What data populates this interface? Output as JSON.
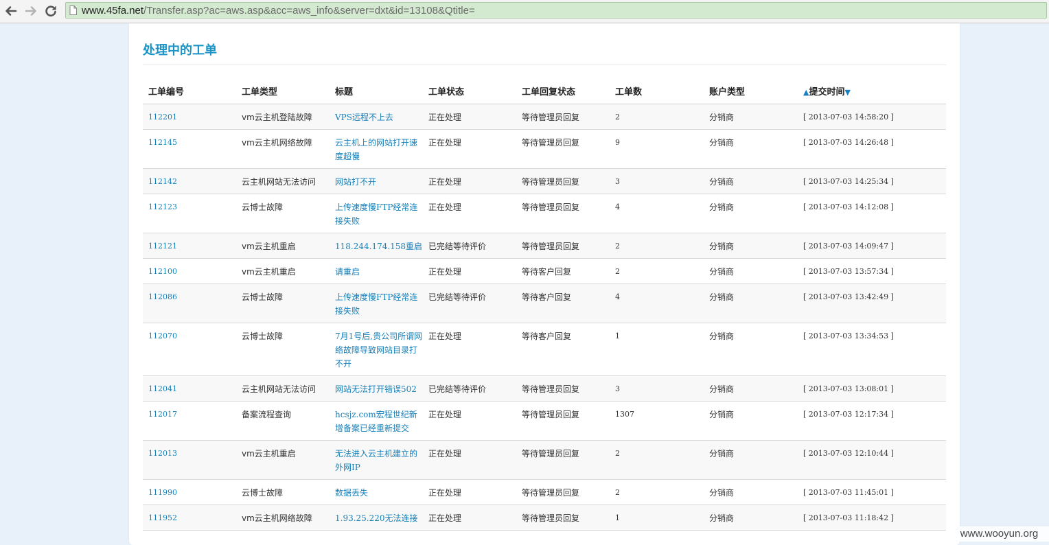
{
  "browser": {
    "url_host": "www.45fa.net",
    "url_path": "/Transfer.asp?ac=aws.asp&acc=aws_info&server=dxt&id=13108&Qtitle=",
    "icons": [
      "back-arrow-icon",
      "forward-arrow-icon",
      "reload-icon",
      "page-icon"
    ]
  },
  "page": {
    "title": "处理中的工单"
  },
  "table": {
    "headers": {
      "id": "工单编号",
      "category": "工单类型",
      "subject": "标题",
      "status": "工单状态",
      "reply_status": "工单回复状态",
      "count": "工单数",
      "account": "账户类型",
      "time": "提交时间"
    },
    "sort_up": "▲",
    "sort_down": "▼",
    "rows": [
      {
        "id": "112201",
        "category": "vm云主机登陆故障",
        "subject": "VPS远程不上去",
        "status": "正在处理",
        "reply_status": "等待管理员回复",
        "count": "2",
        "account": "分销商",
        "time": "[ 2013-07-03 14:58:20 ]"
      },
      {
        "id": "112145",
        "category": "vm云主机网络故障",
        "subject": "云主机上的网站打开速度超慢",
        "status": "正在处理",
        "reply_status": "等待管理员回复",
        "count": "9",
        "account": "分销商",
        "time": "[ 2013-07-03 14:26:48 ]"
      },
      {
        "id": "112142",
        "category": "云主机网站无法访问",
        "subject": "网站打不开",
        "status": "正在处理",
        "reply_status": "等待管理员回复",
        "count": "3",
        "account": "分销商",
        "time": "[ 2013-07-03 14:25:34 ]"
      },
      {
        "id": "112123",
        "category": "云博士故障",
        "subject": "上传速度慢FTP经常连接失败",
        "status": "正在处理",
        "reply_status": "等待管理员回复",
        "count": "4",
        "account": "分销商",
        "time": "[ 2013-07-03 14:12:08 ]"
      },
      {
        "id": "112121",
        "category": "vm云主机重启",
        "subject": "118.244.174.158重启",
        "status": "已完结等待评价",
        "reply_status": "等待管理员回复",
        "count": "2",
        "account": "分销商",
        "time": "[ 2013-07-03 14:09:47 ]"
      },
      {
        "id": "112100",
        "category": "vm云主机重启",
        "subject": "请重启",
        "status": "正在处理",
        "reply_status": "等待客户回复",
        "count": "2",
        "account": "分销商",
        "time": "[ 2013-07-03 13:57:34 ]"
      },
      {
        "id": "112086",
        "category": "云博士故障",
        "subject": "上传速度慢FTP经常连接失败",
        "status": "已完结等待评价",
        "reply_status": "等待客户回复",
        "count": "4",
        "account": "分销商",
        "time": "[ 2013-07-03 13:42:49 ]"
      },
      {
        "id": "112070",
        "category": "云博士故障",
        "subject": "7月1号后,贵公司所谓网络故障导致网站目录打不开",
        "status": "正在处理",
        "reply_status": "等待客户回复",
        "count": "1",
        "account": "分销商",
        "time": "[ 2013-07-03 13:34:53 ]"
      },
      {
        "id": "112041",
        "category": "云主机网站无法访问",
        "subject": "网站无法打开错误502",
        "status": "已完结等待评价",
        "reply_status": "等待管理员回复",
        "count": "3",
        "account": "分销商",
        "time": "[ 2013-07-03 13:08:01 ]"
      },
      {
        "id": "112017",
        "category": "备案流程查询",
        "subject": "hcsjz.com宏程世纪新增备案已经重新提交",
        "status": "正在处理",
        "reply_status": "等待管理员回复",
        "count": "1307",
        "account": "分销商",
        "time": "[ 2013-07-03 12:17:34 ]"
      },
      {
        "id": "112013",
        "category": "vm云主机重启",
        "subject": "无法进入云主机建立的外网IP",
        "status": "正在处理",
        "reply_status": "等待管理员回复",
        "count": "2",
        "account": "分销商",
        "time": "[ 2013-07-03 12:10:44 ]"
      },
      {
        "id": "111990",
        "category": "云博士故障",
        "subject": "数据丢失",
        "status": "正在处理",
        "reply_status": "等待管理员回复",
        "count": "2",
        "account": "分销商",
        "time": "[ 2013-07-03 11:45:01 ]"
      },
      {
        "id": "111952",
        "category": "vm云主机网络故障",
        "subject": "1.93.25.220无法连接",
        "status": "正在处理",
        "reply_status": "等待管理员回复",
        "count": "1",
        "account": "分销商",
        "time": "[ 2013-07-03 11:18:42 ]"
      }
    ]
  },
  "watermark": "www.wooyun.org"
}
